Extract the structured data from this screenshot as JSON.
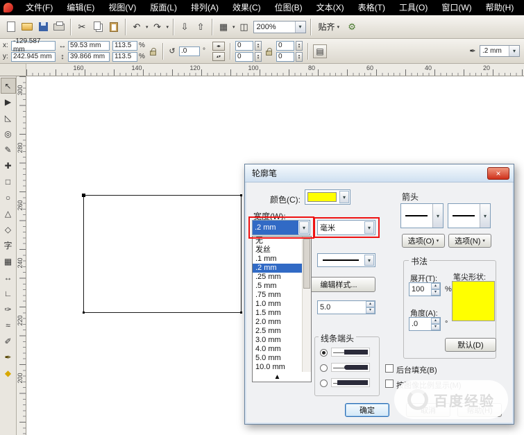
{
  "colors": {
    "selection_blue": "#316ac5",
    "annotation_red": "#ee1111",
    "outline_yellow": "#ffff00",
    "menubar_black": "#000000"
  },
  "menu_bar": {
    "items": [
      "文件(F)",
      "编辑(E)",
      "视图(V)",
      "版面(L)",
      "排列(A)",
      "效果(C)",
      "位图(B)",
      "文本(X)",
      "表格(T)",
      "工具(O)",
      "窗口(W)",
      "帮助(H)"
    ]
  },
  "toolbar": {
    "zoom_value": "200%",
    "snap_label": "贴齐",
    "cut_glyph": "✂",
    "undo_glyph": "↶",
    "redo_glyph": "↷",
    "import_glyph": "⇩",
    "export_glyph": "⇧",
    "launcher_glyph": "▦",
    "welcome_glyph": "◫",
    "options_glyph": "⚙"
  },
  "property_bar": {
    "x_label": "x:",
    "x_value": "-129.587 mm",
    "y_label": "y:",
    "y_value": "242.945 mm",
    "width_icon": "↔",
    "width_value": "59.53 mm",
    "height_icon": "↕",
    "height_value": "39.866 mm",
    "scale_x": "113.5",
    "scale_y": "113.5",
    "percent": "%",
    "rotate_icon": "↺",
    "rotate_value": ".0",
    "degree": "°",
    "mirror_h_glyph": "◂▸",
    "mirror_v_glyph": "▴▾",
    "corner_values": [
      "0",
      "0",
      "0",
      "0"
    ],
    "wrap_glyph": "▤",
    "outline_pen_glyph": "✒",
    "outline_width": ".2 mm"
  },
  "rulers": {
    "horizontal": [
      "160",
      "140",
      "120",
      "100",
      "80",
      "60",
      "40",
      "20"
    ],
    "vertical": [
      "300",
      "280",
      "260",
      "240",
      "220",
      "200"
    ]
  },
  "toolbox": {
    "tools": [
      {
        "name": "pick-tool",
        "glyph": "↖"
      },
      {
        "name": "shape-tool",
        "glyph": "▶"
      },
      {
        "name": "crop-tool",
        "glyph": "◺"
      },
      {
        "name": "zoom-tool",
        "glyph": "◎"
      },
      {
        "name": "freehand-tool",
        "glyph": "✎"
      },
      {
        "name": "smart-fill-tool",
        "glyph": "✚"
      },
      {
        "name": "rectangle-tool",
        "glyph": "□"
      },
      {
        "name": "ellipse-tool",
        "glyph": "○"
      },
      {
        "name": "polygon-tool",
        "glyph": "△"
      },
      {
        "name": "basic-shapes-tool",
        "glyph": "◇"
      },
      {
        "name": "text-tool",
        "glyph": "字"
      },
      {
        "name": "table-tool",
        "glyph": "▦"
      },
      {
        "name": "dimension-tool",
        "glyph": "↔"
      },
      {
        "name": "connector-tool",
        "glyph": "∟"
      },
      {
        "name": "artistic-media-tool",
        "glyph": "✑"
      },
      {
        "name": "blend-tool",
        "glyph": "≈"
      },
      {
        "name": "eyedropper-tool",
        "glyph": "✐"
      },
      {
        "name": "outline-pen-tool",
        "glyph": "✒"
      },
      {
        "name": "fill-tool",
        "glyph": "◆"
      }
    ]
  },
  "dialog": {
    "title": "轮廓笔",
    "close_glyph": "×",
    "color_label": "颜色(C):",
    "arrows_label": "箭头",
    "width_label": "宽度(W):",
    "width_value": ".2 mm",
    "unit_value": "毫米",
    "options_left": "选项(O)",
    "options_right": "选项(N)",
    "edit_style_button": "编辑样式...",
    "miter_value": "5.0",
    "calligraphy_label": "书法",
    "stretch_label": "展开(T):",
    "stretch_value": "100",
    "percent": "%",
    "nib_label": "笔尖形状:",
    "angle_label": "角度(A):",
    "angle_value": ".0",
    "degree": "°",
    "default_button": "默认(D)",
    "caps_label": "线条端头",
    "behind_fill_label": "后台填充(B)",
    "scale_with_image_label": "按图像比例显示(M)",
    "ok_button": "确定",
    "cancel_button": "取消",
    "help_button": "帮助(H)",
    "width_list": {
      "items": [
        "无",
        "发丝",
        ".1 mm",
        ".2 mm",
        ".25 mm",
        ".5 mm",
        ".75 mm",
        "1.0 mm",
        "1.5 mm",
        "2.0 mm",
        "2.5 mm",
        "3.0 mm",
        "4.0 mm",
        "5.0 mm",
        "10.0 mm"
      ],
      "selected": ".2 mm"
    }
  },
  "watermark": {
    "text": "百度经验"
  }
}
